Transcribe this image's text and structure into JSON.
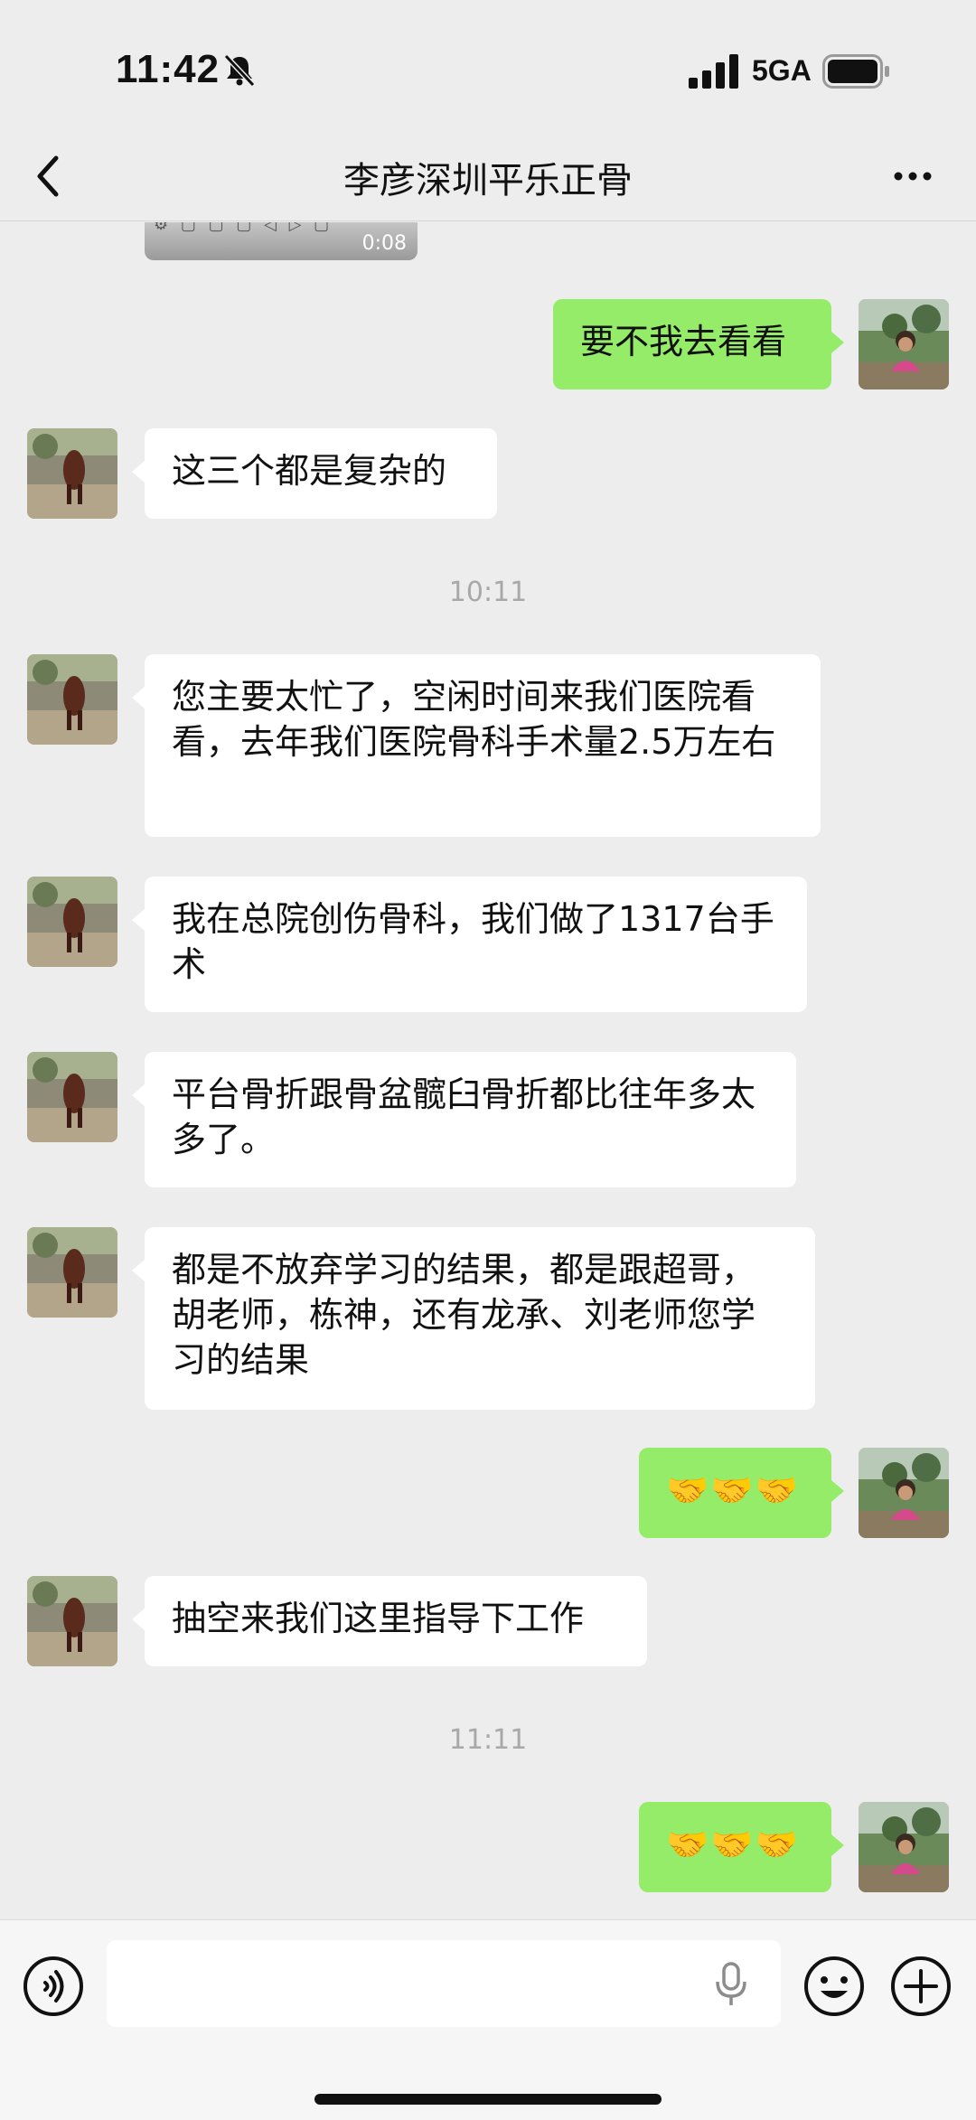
{
  "status": {
    "time": "11:42",
    "network": "5GA",
    "icons": [
      "bell-slash-icon",
      "signal-icon",
      "battery-icon"
    ]
  },
  "nav": {
    "title": "李彦深圳平乐正骨",
    "back_icon": "chevron-left-icon",
    "more_icon": "more-dots-icon"
  },
  "video": {
    "duration": "0:08",
    "controls": "⚙ ▢ ▢ ▢ ◁ ▷ ▢"
  },
  "messages": [
    {
      "side": "out",
      "text": "要不我去看看"
    },
    {
      "side": "in",
      "text": "这三个都是复杂的"
    },
    {
      "type": "timestamp",
      "text": "10:11"
    },
    {
      "side": "in",
      "text": "您主要太忙了，空闲时间来我们医院看看，去年我们医院骨科手术量2.5万左右"
    },
    {
      "side": "in",
      "text": "我在总院创伤骨科，我们做了1317台手术"
    },
    {
      "side": "in",
      "text": "平台骨折跟骨盆髋臼骨折都比往年多太多了。"
    },
    {
      "side": "in",
      "text": "都是不放弃学习的结果，都是跟超哥，胡老师，栋神，还有龙承、刘老师您学习的结果"
    },
    {
      "side": "out",
      "text": "🤝🤝🤝"
    },
    {
      "side": "in",
      "text": "抽空来我们这里指导下工作"
    },
    {
      "type": "timestamp",
      "text": "11:11"
    },
    {
      "side": "out",
      "text": "🤝🤝🤝"
    }
  ],
  "input": {
    "placeholder": "",
    "icons": [
      "voice-icon",
      "mic-icon",
      "emoji-icon",
      "plus-icon"
    ]
  },
  "colors": {
    "background": "#ededed",
    "outgoing": "#95ec69",
    "incoming": "#ffffff"
  }
}
